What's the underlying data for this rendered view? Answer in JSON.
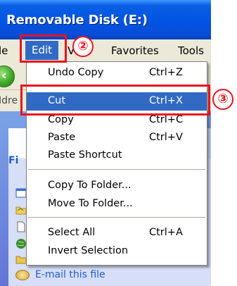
{
  "window": {
    "title": "Removable Disk (E:)"
  },
  "menubar": {
    "items": [
      {
        "label": "le"
      },
      {
        "label": "Edit"
      },
      {
        "label": "View"
      },
      {
        "label": "Favorites"
      },
      {
        "label": "Tools"
      }
    ]
  },
  "address": {
    "label_partial": "Idre"
  },
  "taskpane": {
    "header_partial": "Fi",
    "email_link": "E-mail this file"
  },
  "edit_menu": {
    "items": [
      {
        "label": "Undo Copy",
        "shortcut": "Ctrl+Z"
      },
      {
        "label": "Cut",
        "shortcut": "Ctrl+X",
        "highlighted": true
      },
      {
        "label": "Copy",
        "shortcut": "Ctrl+C"
      },
      {
        "label": "Paste",
        "shortcut": "Ctrl+V"
      },
      {
        "label": "Paste Shortcut",
        "shortcut": ""
      },
      {
        "label": "Copy To Folder...",
        "shortcut": ""
      },
      {
        "label": "Move To Folder...",
        "shortcut": ""
      },
      {
        "label": "Select All",
        "shortcut": "Ctrl+A"
      },
      {
        "label": "Invert Selection",
        "shortcut": ""
      }
    ]
  },
  "annotations": {
    "step2": "②",
    "step3": "③"
  },
  "colors": {
    "title_blue": "#0054e3",
    "highlight": "#316ac5",
    "annotation_red": "#e8141d"
  },
  "icons": [
    "back-arrow-icon",
    "mail-icon",
    "folder-icon",
    "file-icon"
  ]
}
